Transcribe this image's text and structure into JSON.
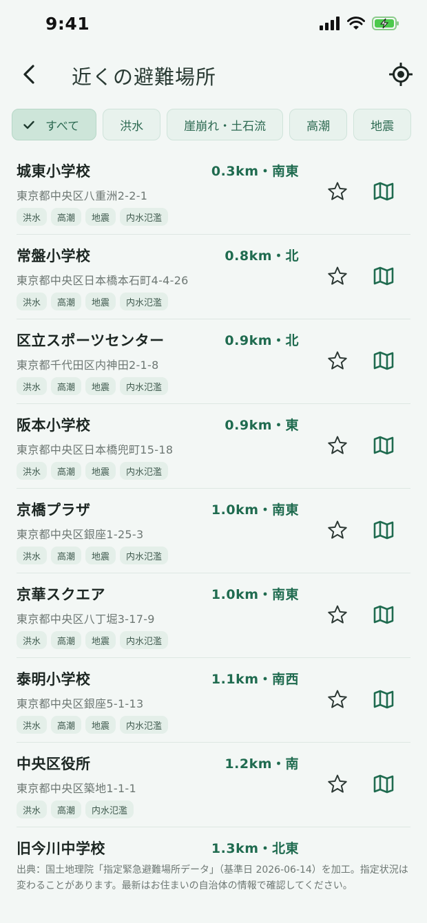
{
  "status": {
    "time": "9:41"
  },
  "header": {
    "title": "近くの避難場所"
  },
  "filters": [
    {
      "label": "すべて",
      "active": true
    },
    {
      "label": "洪水",
      "active": false
    },
    {
      "label": "崖崩れ・土石流",
      "active": false
    },
    {
      "label": "高潮",
      "active": false
    },
    {
      "label": "地震",
      "active": false
    }
  ],
  "shelters": [
    {
      "name": "城東小学校",
      "distance": "0.3km・南東",
      "address": "東京都中央区八重洲2-2-1",
      "tags": [
        "洪水",
        "高潮",
        "地震",
        "内水氾濫"
      ]
    },
    {
      "name": "常盤小学校",
      "distance": "0.8km・北",
      "address": "東京都中央区日本橋本石町4-4-26",
      "tags": [
        "洪水",
        "高潮",
        "地震",
        "内水氾濫"
      ]
    },
    {
      "name": "区立スポーツセンター",
      "distance": "0.9km・北",
      "address": "東京都千代田区内神田2-1-8",
      "tags": [
        "洪水",
        "高潮",
        "地震",
        "内水氾濫"
      ]
    },
    {
      "name": "阪本小学校",
      "distance": "0.9km・東",
      "address": "東京都中央区日本橋兜町15-18",
      "tags": [
        "洪水",
        "高潮",
        "地震",
        "内水氾濫"
      ]
    },
    {
      "name": "京橋プラザ",
      "distance": "1.0km・南東",
      "address": "東京都中央区銀座1-25-3",
      "tags": [
        "洪水",
        "高潮",
        "地震",
        "内水氾濫"
      ]
    },
    {
      "name": "京華スクエア",
      "distance": "1.0km・南東",
      "address": "東京都中央区八丁堀3-17-9",
      "tags": [
        "洪水",
        "高潮",
        "地震",
        "内水氾濫"
      ]
    },
    {
      "name": "泰明小学校",
      "distance": "1.1km・南西",
      "address": "東京都中央区銀座5-1-13",
      "tags": [
        "洪水",
        "高潮",
        "地震",
        "内水氾濫"
      ]
    },
    {
      "name": "中央区役所",
      "distance": "1.2km・南",
      "address": "東京都中央区築地1-1-1",
      "tags": [
        "洪水",
        "高潮",
        "内水氾濫"
      ]
    },
    {
      "name": "旧今川中学校",
      "distance": "1.3km・北東",
      "address": "",
      "tags": []
    }
  ],
  "footer": {
    "note": "出典：国土地理院「指定緊急避難場所データ」（基準日 2026-06-14）を加工。指定状況は変わることがあります。最新はお住まいの自治体の情報で確認してください。"
  },
  "colors": {
    "accent": "#1f6b4f",
    "background": "#f3f7f5",
    "chip": "#e8f2ed",
    "chip_active": "#cde5d9"
  },
  "icons": {
    "back": "chevron-left-icon",
    "locate": "crosshair-icon",
    "favorite": "star-outline-icon",
    "map": "map-icon",
    "check": "check-icon"
  }
}
